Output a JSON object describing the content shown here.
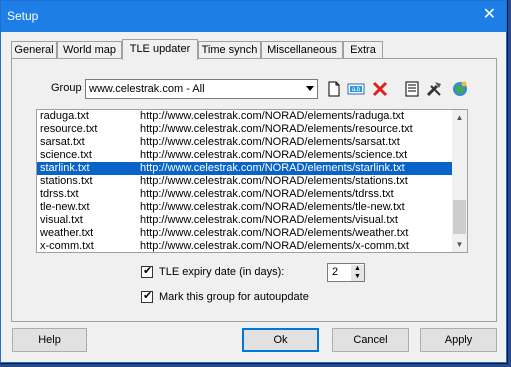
{
  "window": {
    "title": "Setup",
    "close_glyph": "✕"
  },
  "tabs": [
    {
      "label": "General"
    },
    {
      "label": "World map"
    },
    {
      "label": "TLE updater",
      "active": true
    },
    {
      "label": "Time synch"
    },
    {
      "label": "Miscellaneous"
    },
    {
      "label": "Extra"
    }
  ],
  "group": {
    "label": "Group",
    "value": "www.celestrak.com - All"
  },
  "toolbar_icons": [
    "new-document-icon",
    "rename-icon",
    "delete-icon",
    "properties-icon",
    "tools-icon",
    "globe-update-icon"
  ],
  "tle_list": {
    "rows": [
      {
        "name": "raduga.txt",
        "url": "http://www.celestrak.com/NORAD/elements/raduga.txt"
      },
      {
        "name": "resource.txt",
        "url": "http://www.celestrak.com/NORAD/elements/resource.txt"
      },
      {
        "name": "sarsat.txt",
        "url": "http://www.celestrak.com/NORAD/elements/sarsat.txt"
      },
      {
        "name": "science.txt",
        "url": "http://www.celestrak.com/NORAD/elements/science.txt"
      },
      {
        "name": "starlink.txt",
        "url": "http://www.celestrak.com/NORAD/elements/starlink.txt",
        "selected": true
      },
      {
        "name": "stations.txt",
        "url": "http://www.celestrak.com/NORAD/elements/stations.txt"
      },
      {
        "name": "tdrss.txt",
        "url": "http://www.celestrak.com/NORAD/elements/tdrss.txt"
      },
      {
        "name": "tle-new.txt",
        "url": "http://www.celestrak.com/NORAD/elements/tle-new.txt"
      },
      {
        "name": "visual.txt",
        "url": "http://www.celestrak.com/NORAD/elements/visual.txt"
      },
      {
        "name": "weather.txt",
        "url": "http://www.celestrak.com/NORAD/elements/weather.txt"
      },
      {
        "name": "x-comm.txt",
        "url": "http://www.celestrak.com/NORAD/elements/x-comm.txt"
      }
    ]
  },
  "options": {
    "expiry_label": "TLE expiry date (in days):",
    "expiry_checked": true,
    "expiry_days": "2",
    "autoupdate_label": "Mark this group for autoupdate",
    "autoupdate_checked": true,
    "check_glyph": "✔"
  },
  "buttons": {
    "help": "Help",
    "ok": "Ok",
    "cancel": "Cancel",
    "apply": "Apply"
  },
  "colors": {
    "title_bar": "#1e7ee8",
    "selection": "#0a64c8",
    "delete_red": "#e02020"
  }
}
